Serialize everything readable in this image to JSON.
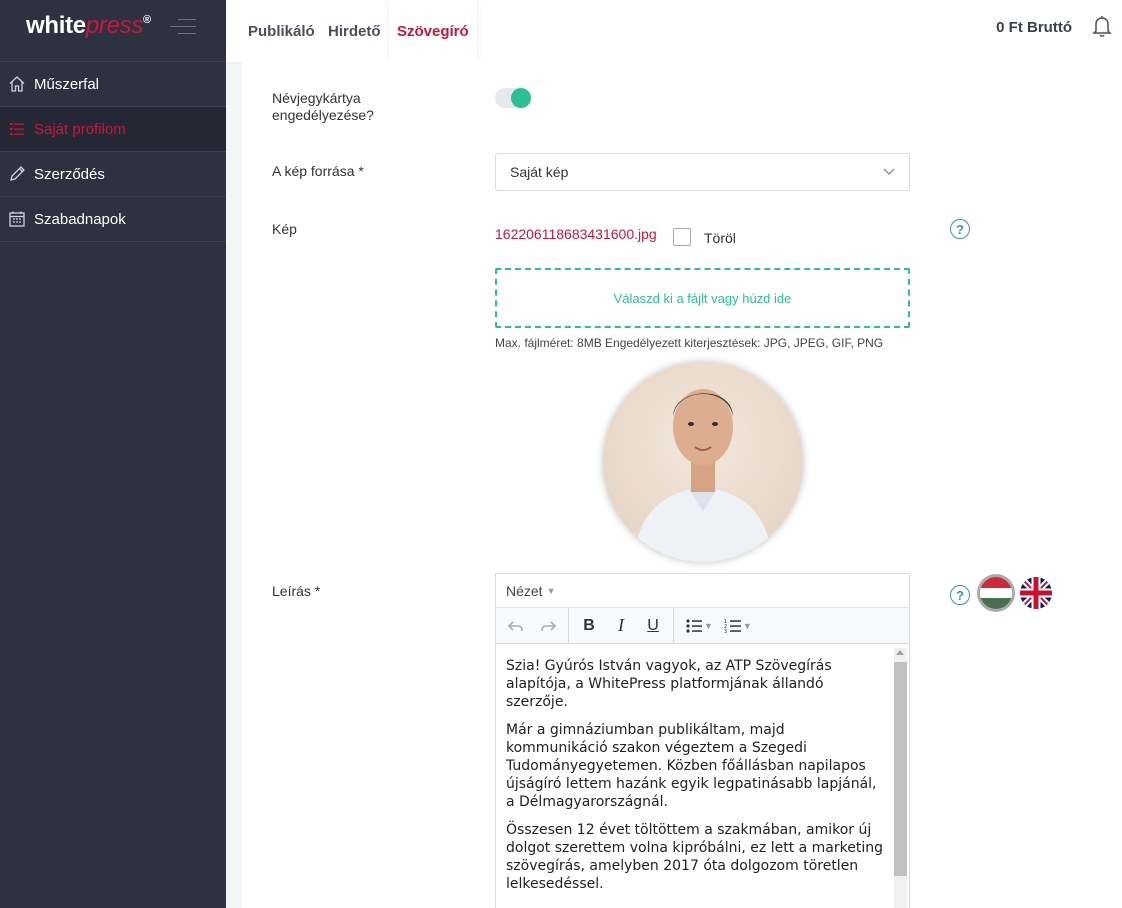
{
  "brand": {
    "white": "white",
    "press": "press",
    "reg": "®"
  },
  "sidebar": {
    "items": [
      {
        "label": "Műszerfal",
        "icon": "home-icon",
        "active": false
      },
      {
        "label": "Saját profilom",
        "icon": "list-icon",
        "active": true
      },
      {
        "label": "Szerződés",
        "icon": "pencil-icon",
        "active": false
      },
      {
        "label": "Szabadnapok",
        "icon": "calendar-icon",
        "active": false
      }
    ]
  },
  "topbar": {
    "tabs": [
      {
        "label": "Publikáló"
      },
      {
        "label": "Hirdető"
      },
      {
        "label": "Szövegíró"
      }
    ],
    "balance": "0 Ft Bruttó"
  },
  "form": {
    "business_card_label": "Névjegykártya engedélyezése?",
    "business_card_enabled": true,
    "image_source_label": "A kép forrása *",
    "image_source_value": "Saját kép",
    "image_label": "Kép",
    "image_file": "162206118683431600.jpg",
    "delete_label": "Töröl",
    "dropzone_text": "Válaszd ki a fájlt vagy húzd ide",
    "file_hint": "Max. fájlméret: 8MB Engedélyezett kiterjesztések: JPG, JPEG, GIF, PNG",
    "description_label": "Leírás *",
    "help_glyph": "?"
  },
  "editor": {
    "menu_label": "Nézet",
    "paragraphs": [
      "Szia! Gyúrós István vagyok, az ATP Szövegírás alapítója, a WhitePress platformjának állandó szerzője.",
      "Már a gimnáziumban publikáltam, majd kommunikáció szakon végeztem a Szegedi Tudományegyetemen. Közben főállásban napilapos újságíró lettem hazánk egyik legpatinásabb lapjánál, a Délmagyarországnál.",
      "Összesen 12 évet töltöttem a szakmában, amikor új dolgot szerettem volna kipróbálni, ez lett a marketing szövegírás, amelyben 2017 óta dolgozom töretlen lelkesedéssel."
    ]
  },
  "colors": {
    "accent": "#c8163c",
    "green": "#2bbf96",
    "sidebar": "#2d3241",
    "help": "#3a8fd4"
  }
}
